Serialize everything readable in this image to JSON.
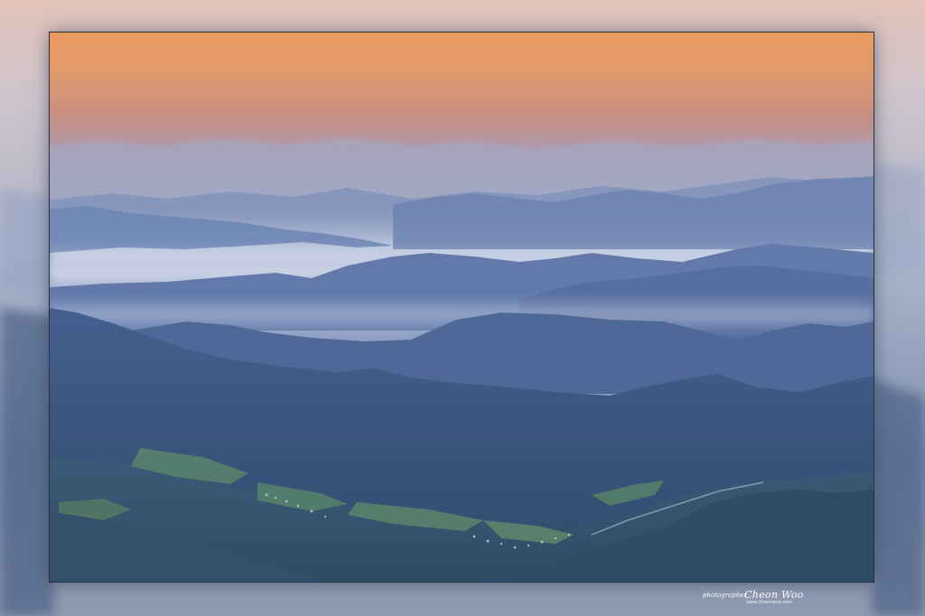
{
  "scene": {
    "subject": "mountain-ridges-at-dawn",
    "colors": {
      "sky_top": "#e79a62",
      "sky_mid": "#c9917f",
      "haze": "#9aa7c4",
      "ridge_far": "#7d8fb9",
      "ridge_mid": "#5f78a8",
      "ridge_near": "#3f5a86",
      "valley": "#34506e",
      "field_green": "#5b8a6a",
      "frame_glow": "#c8c4cc"
    }
  },
  "signature": {
    "prefix": "photographer",
    "name": "Cheon Woo",
    "sub": "www.cheonwoo.com"
  }
}
